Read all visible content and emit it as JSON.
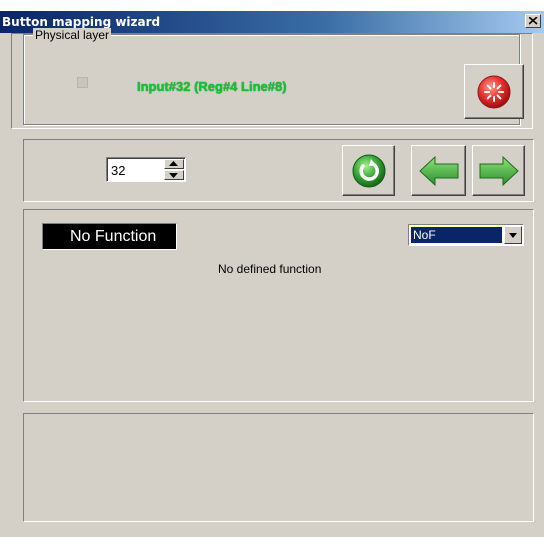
{
  "window": {
    "title": "Button mapping wizard",
    "close_icon": "close-icon"
  },
  "physical_layer": {
    "group_label": "Physical layer",
    "checkbox_checked": false,
    "input_info": "Input#32  (Reg#4  Line#8)",
    "input_info_color": "#0cc82c",
    "stop_icon": "red-stop-icon"
  },
  "navigation": {
    "spinner_value": "32",
    "refresh_icon": "refresh-icon",
    "back_icon": "arrow-left-icon",
    "forward_icon": "arrow-right-icon"
  },
  "function": {
    "name": "No Function",
    "selected_option": "NoF",
    "description": "No defined function"
  },
  "colors": {
    "face": "#d4d0c8",
    "title_start": "#0a246a",
    "title_end": "#a6caf0",
    "selection": "#0a246a",
    "green": "#3aa83a",
    "red": "#e8312f"
  }
}
